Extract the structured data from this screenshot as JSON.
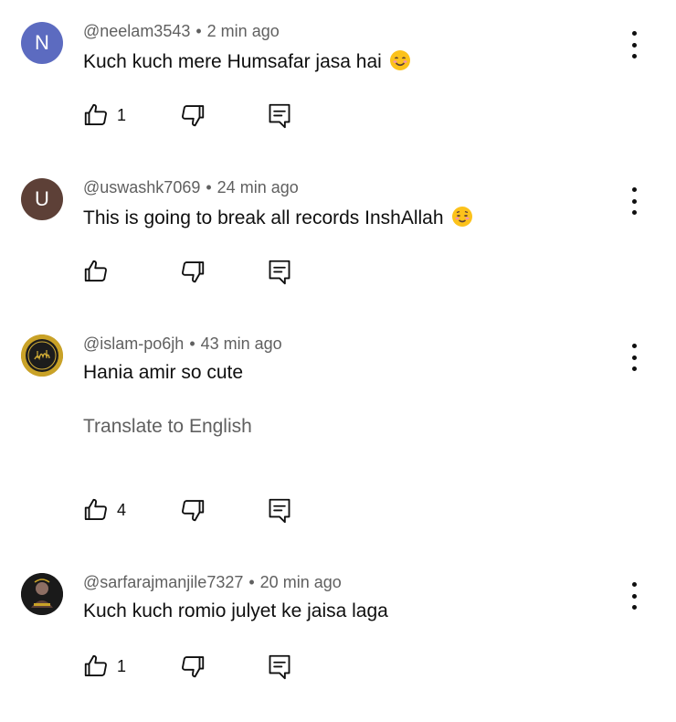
{
  "comments": [
    {
      "avatar_letter": "N",
      "avatar_color": "#5c6bc0",
      "handle": "@neelam3543",
      "separator": "•",
      "time": "2 min ago",
      "text": "Kuch kuch mere Humsafar jasa hai",
      "emoji": "smiling-face-icon",
      "likes": "1"
    },
    {
      "avatar_letter": "U",
      "avatar_color": "#5d4037",
      "handle": "@uswashk7069",
      "separator": "•",
      "time": "24 min ago",
      "text": "This is going to break all records InshAllah",
      "emoji": "relieved-face-icon",
      "likes": ""
    },
    {
      "avatar_letter": "",
      "avatar_color": "#b8860b",
      "handle": "@islam-po6jh",
      "separator": "•",
      "time": "43 min ago",
      "text": "Hania amir so cute",
      "translate": "Translate to English",
      "likes": "4"
    },
    {
      "avatar_letter": "",
      "avatar_color": "#1a1a1a",
      "handle": "@sarfarajmanjile7327",
      "separator": "•",
      "time": "20 min ago",
      "text": "Kuch kuch romio julyet ke jaisa laga",
      "likes": "1"
    }
  ]
}
